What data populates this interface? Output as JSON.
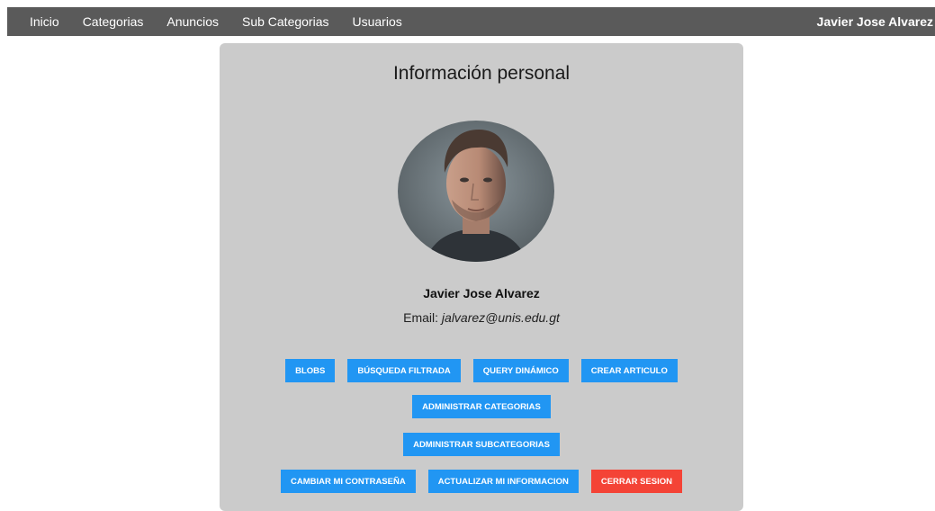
{
  "navbar": {
    "links": [
      "Inicio",
      "Categorias",
      "Anuncios",
      "Sub Categorias",
      "Usuarios"
    ],
    "user_name": "Javier Jose Alvarez"
  },
  "profile": {
    "title": "Información personal",
    "name": "Javier Jose Alvarez",
    "email_label": "Email:",
    "email": "jalvarez@unis.edu.gt"
  },
  "actions": {
    "blobs": "BLOBS",
    "busqueda_filtrada": "BÚSQUEDA FILTRADA",
    "query_dinamico": "QUERY DINÁMICO",
    "crear_articulo": "CREAR ARTICULO",
    "administrar_categorias": "ADMINISTRAR CATEGORIAS",
    "administrar_subcategorias": "ADMINISTRAR SUBCATEGORIAS",
    "cambiar_contrasena": "CAMBIAR MI CONTRASEÑA",
    "actualizar_informacion": "ACTUALIZAR MI INFORMACION",
    "cerrar_sesion": "CERRAR SESION"
  },
  "colors": {
    "navbar_bg": "#5a5a5a",
    "card_bg": "#cbcbcb",
    "primary_button": "#2196f3",
    "danger_button": "#f44336"
  }
}
